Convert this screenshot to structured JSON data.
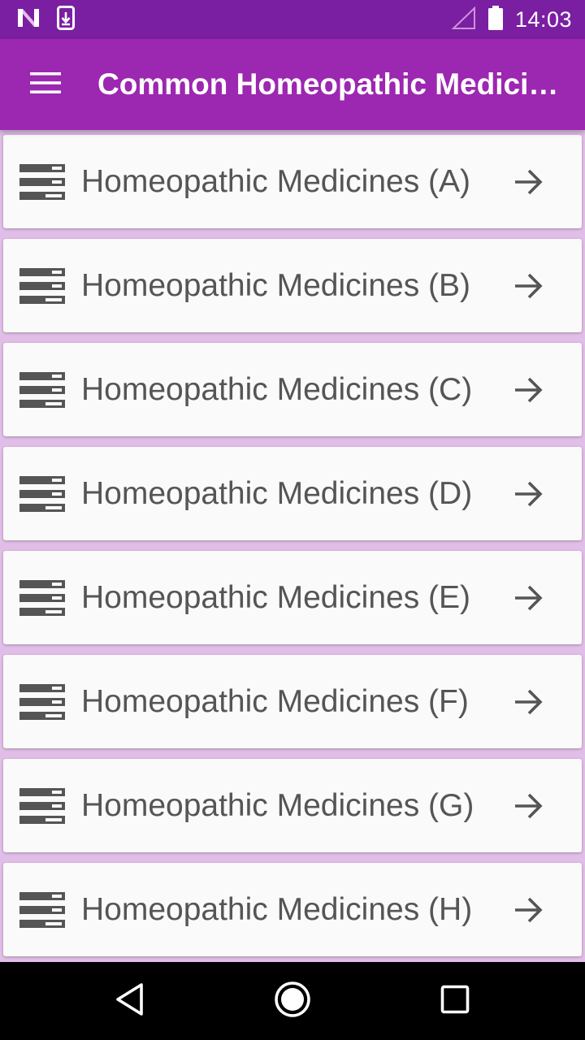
{
  "status_bar": {
    "time": "14:03",
    "icons": [
      "notification-n-icon",
      "download-icon",
      "signal-icon",
      "battery-icon"
    ]
  },
  "app_bar": {
    "title": "Common Homeopathic Medicines",
    "menu_icon": "hamburger-menu-icon"
  },
  "list": {
    "items": [
      {
        "label": "Homeopathic Medicines (A)",
        "letter": "a"
      },
      {
        "label": "Homeopathic Medicines (B)",
        "letter": "b"
      },
      {
        "label": "Homeopathic Medicines (C)",
        "letter": "c"
      },
      {
        "label": "Homeopathic Medicines (D)",
        "letter": "d"
      },
      {
        "label": "Homeopathic Medicines (E)",
        "letter": "e"
      },
      {
        "label": "Homeopathic Medicines (F)",
        "letter": "f"
      },
      {
        "label": "Homeopathic Medicines (G)",
        "letter": "g"
      },
      {
        "label": "Homeopathic Medicines (H)",
        "letter": "h"
      }
    ],
    "item_icon": "list-view-icon",
    "trailing_icon": "arrow-right-icon"
  },
  "nav_bar": {
    "icons": [
      "back-icon",
      "home-icon",
      "recents-icon"
    ]
  },
  "colors": {
    "status_bar": "#7B1FA2",
    "app_bar": "#9C27B0",
    "background": "#E1BEE7",
    "card": "#FAFAFA",
    "text": "#555555",
    "nav_bar": "#000000"
  }
}
